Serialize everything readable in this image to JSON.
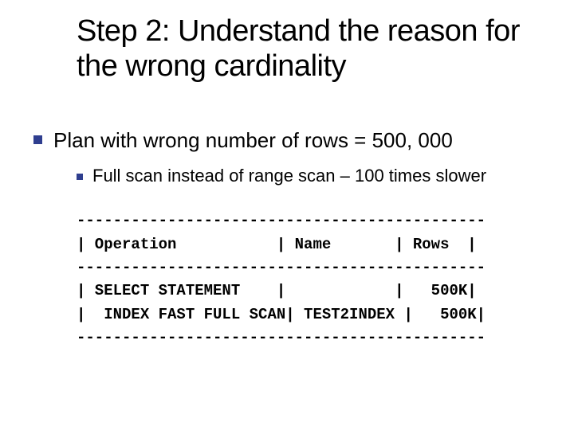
{
  "title": "Step 2: Understand the reason for the wrong cardinality",
  "bullet1": "Plan with wrong number of rows = 500, 000",
  "bullet2": "Full scan instead of range scan – 100 times slower",
  "plan_line1": "---------------------------------------------",
  "plan_line2": "| Operation           | Name       | Rows  |",
  "plan_line3": "---------------------------------------------",
  "plan_line4": "| SELECT STATEMENT    |            |   500K|",
  "plan_line5": "|  INDEX FAST FULL SCAN| TEST2INDEX |   500K|",
  "plan_line6": "---------------------------------------------"
}
